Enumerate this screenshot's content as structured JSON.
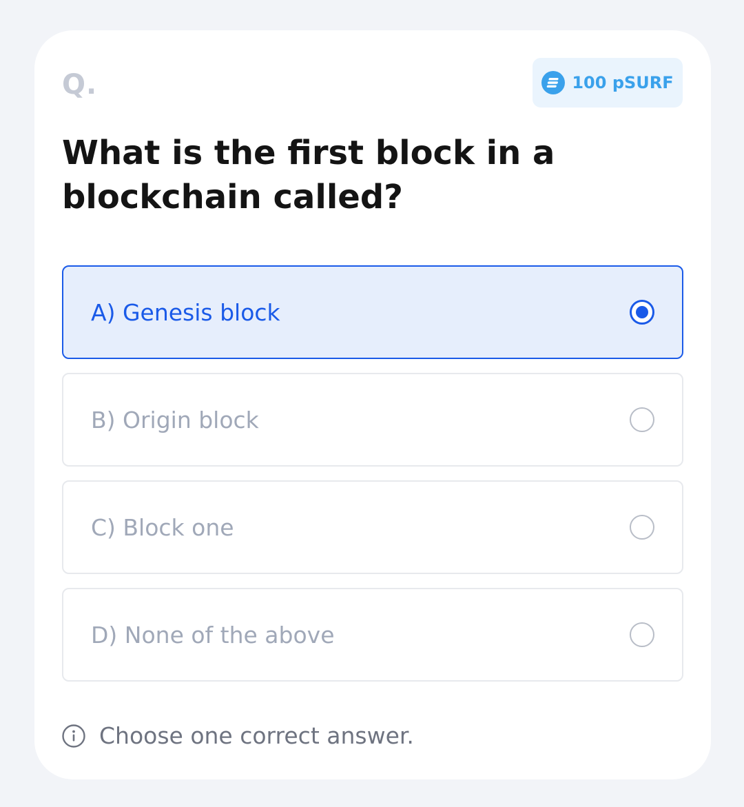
{
  "header": {
    "q_label": "Q.",
    "reward": {
      "icon": "coin-icon",
      "amount": "100 pSURF",
      "color": "#3aa1eb"
    }
  },
  "question": {
    "text": "What is the first block in a blockchain called?"
  },
  "options": [
    {
      "label": "A) Genesis block",
      "selected": true
    },
    {
      "label": "B) Origin block",
      "selected": false
    },
    {
      "label": "C) Block one",
      "selected": false
    },
    {
      "label": "D) None of the above",
      "selected": false
    }
  ],
  "hint": {
    "icon": "info-icon",
    "text": "Choose one correct answer."
  },
  "colors": {
    "accent": "#1a5ae8",
    "selected_bg": "#e6eefc",
    "muted_text": "#a0a8b8"
  }
}
